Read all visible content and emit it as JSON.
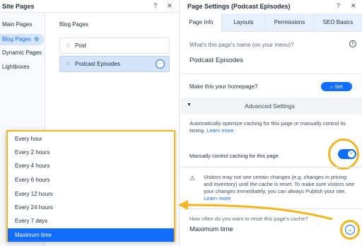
{
  "left_panel": {
    "title": "Site Pages",
    "help": "?",
    "close": "✕",
    "nav": [
      {
        "label": "Main Pages"
      },
      {
        "label": "Blog Pages"
      },
      {
        "label": "Dynamic Pages"
      },
      {
        "label": "Lightboxes"
      }
    ],
    "section_title": "Blog Pages",
    "pages": [
      {
        "label": "Post"
      },
      {
        "label": "Podcast Episodes"
      }
    ]
  },
  "right_panel": {
    "title": "Page Settings (Podcast Episodes)",
    "help": "?",
    "close": "✕",
    "tabs": [
      {
        "label": "Page Info"
      },
      {
        "label": "Layouts"
      },
      {
        "label": "Permissions"
      },
      {
        "label": "SEO Basics"
      }
    ],
    "name_label": "What's this page's name (on your menu)?",
    "name_value": "Podcast Episodes",
    "homepage_label": "Make this your homepage?",
    "set_button": "Set",
    "advanced_label": "Advanced Settings",
    "caching_desc": "Automatically optimize caching for this page or manually control its timing.",
    "learn_more_1": "Learn more",
    "toggle_label": "Manually control caching for this page",
    "warning_text": "Visitors may not see certain changes (e.g. changes in pricing and inventory) until the cache is reset. To make sure visitors see your changes immediately, you can always Publish your site.",
    "learn_more_2": "Learn more",
    "reset_label": "How often do you want to reset this page's cache?",
    "reset_value": "Maximum time"
  },
  "dropdown": {
    "options": [
      {
        "label": "Every hour"
      },
      {
        "label": "Every 2 hours"
      },
      {
        "label": "Every 4 hours"
      },
      {
        "label": "Every 6 hours"
      },
      {
        "label": "Every 12 hours"
      },
      {
        "label": "Every 24 hours"
      },
      {
        "label": "Every 7 days"
      },
      {
        "label": "Maximum time"
      }
    ],
    "selected": "Maximum time"
  },
  "colors": {
    "accent": "#116dff",
    "highlight": "#f5b51c",
    "selected_bg": "#d3e4fb"
  }
}
